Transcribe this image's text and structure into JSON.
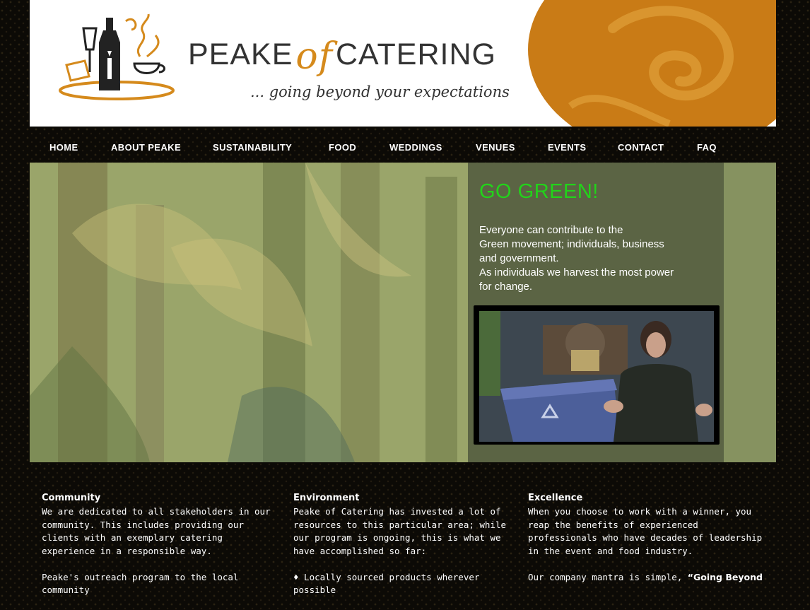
{
  "header": {
    "brand_left": "PEAKE",
    "brand_of": "of",
    "brand_right": "CATERING",
    "tagline": "... going beyond your expectations",
    "accent_color": "#d58a1c"
  },
  "nav": {
    "items": [
      {
        "label": "HOME"
      },
      {
        "label": "ABOUT PEAKE"
      },
      {
        "label": "SUSTAINABILITY"
      },
      {
        "label": "FOOD"
      },
      {
        "label": "WEDDINGS"
      },
      {
        "label": "VENUES"
      },
      {
        "label": "EVENTS"
      },
      {
        "label": "CONTACT"
      },
      {
        "label": "FAQ"
      }
    ]
  },
  "hero": {
    "heading": "GO GREEN!",
    "heading_color": "#22d31a",
    "body": "Everyone can contribute to the\nGreen movement; individuals, business\nand government.\nAs individuals we harvest the most power\nfor change."
  },
  "columns": [
    {
      "title": "Community",
      "paragraph1": "We are dedicated to all stakeholders in our community. This includes providing our clients with an exemplary catering experience in a responsible way.",
      "paragraph2": "Peake's outreach program to the local community"
    },
    {
      "title": "Environment",
      "paragraph1": "Peake of Catering has invested a lot of resources to this particular area; while our program is ongoing, this is what we have accomplished so far:",
      "paragraph2": "♦ Locally sourced products wherever possible"
    },
    {
      "title": "Excellence",
      "paragraph1": "When you choose to work with a winner, you reap the benefits of experienced professionals who have decades of leadership in the event and food industry.",
      "paragraph2": "Our company mantra is simple,",
      "paragraph2_bold": "“Going Beyond"
    }
  ]
}
